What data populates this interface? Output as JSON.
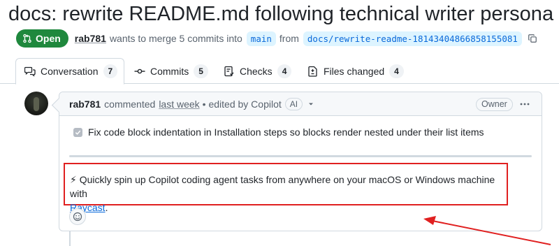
{
  "pr": {
    "title": "docs: rewrite README.md following technical writer persona",
    "state": "Open",
    "author": "rab781",
    "merge_text_1": "wants to merge 5 commits into",
    "base_branch": "main",
    "merge_text_2": "from",
    "head_branch": "docs/rewrite-readme-18143404866858155081"
  },
  "tabs": [
    {
      "label": "Conversation",
      "count": "7",
      "icon": "comment-discussion-icon"
    },
    {
      "label": "Commits",
      "count": "5",
      "icon": "git-commit-icon"
    },
    {
      "label": "Checks",
      "count": "4",
      "icon": "checklist-icon"
    },
    {
      "label": "Files changed",
      "count": "4",
      "icon": "file-diff-icon"
    }
  ],
  "comment": {
    "author": "rab781",
    "action": "commented",
    "time": "last week",
    "edited": "• edited by Copilot",
    "ai_badge": "AI",
    "owner_badge": "Owner",
    "task_item": "Fix code block indentation in Installation steps so blocks render nested under their list items",
    "task_checked": true,
    "promo_text": "⚡ Quickly spin up Copilot coding agent tasks from anywhere on your macOS or Windows machine with",
    "promo_link": "Raycast",
    "promo_end": "."
  },
  "colors": {
    "open_green": "#1f883d",
    "link_blue": "#0969da",
    "annotation_red": "#e02020",
    "branch_bg": "#ddf4ff"
  }
}
